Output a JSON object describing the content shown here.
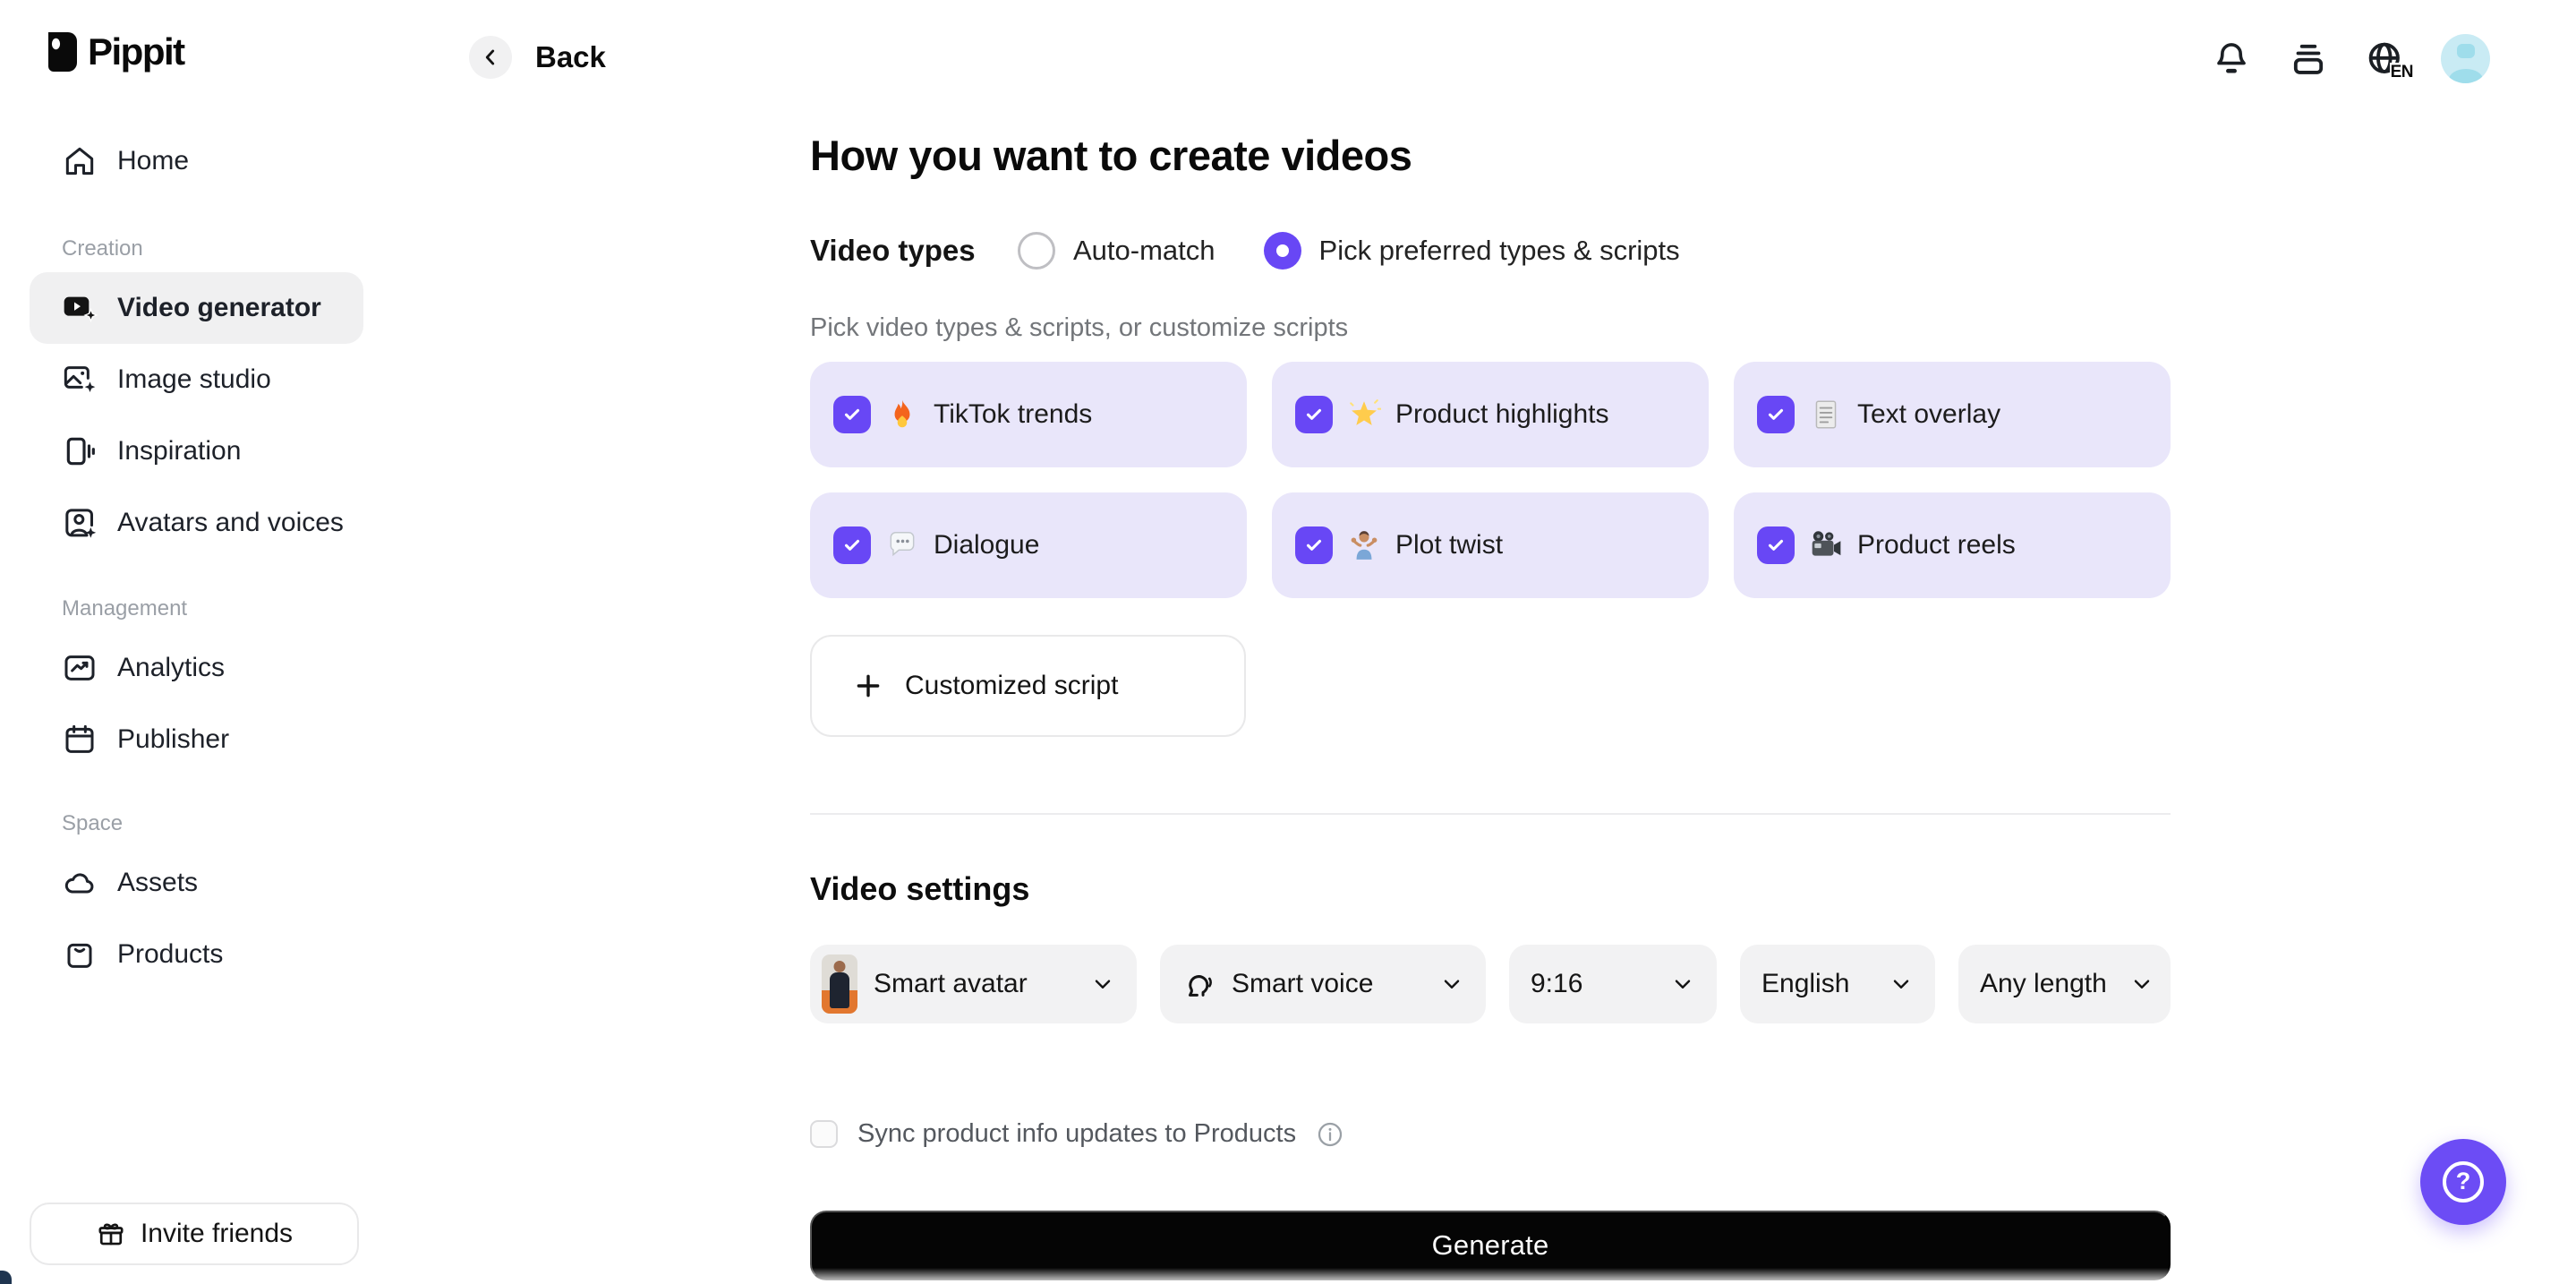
{
  "brand": {
    "name": "Pippit"
  },
  "header": {
    "back_label": "Back",
    "language": "EN"
  },
  "sidebar": {
    "home": {
      "label": "Home"
    },
    "sections": [
      {
        "label": "Creation",
        "items": [
          {
            "label": "Video generator",
            "active": true
          },
          {
            "label": "Image studio",
            "active": false
          },
          {
            "label": "Inspiration",
            "active": false
          },
          {
            "label": "Avatars and voices",
            "active": false
          }
        ]
      },
      {
        "label": "Management",
        "items": [
          {
            "label": "Analytics",
            "active": false
          },
          {
            "label": "Publisher",
            "active": false
          }
        ]
      },
      {
        "label": "Space",
        "items": [
          {
            "label": "Assets",
            "active": false
          },
          {
            "label": "Products",
            "active": false
          }
        ]
      }
    ],
    "invite_label": "Invite friends"
  },
  "main": {
    "title": "How you want to create videos",
    "video_types": {
      "label": "Video types",
      "options": [
        {
          "label": "Auto-match",
          "selected": false
        },
        {
          "label": "Pick preferred types & scripts",
          "selected": true
        }
      ],
      "hint": "Pick video types & scripts, or customize scripts",
      "cards": [
        {
          "emoji": "🔥",
          "label": "TikTok trends",
          "checked": true
        },
        {
          "emoji": "🌟",
          "label": "Product highlights",
          "checked": true
        },
        {
          "emoji": "📃",
          "label": "Text overlay",
          "checked": true
        },
        {
          "emoji": "💬",
          "label": "Dialogue",
          "checked": true
        },
        {
          "emoji": "🤷",
          "label": "Plot twist",
          "checked": true
        },
        {
          "emoji": "🎥",
          "label": "Product reels",
          "checked": true
        }
      ],
      "customized_script_label": "Customized script"
    },
    "video_settings": {
      "title": "Video settings",
      "dropdowns": [
        {
          "label": "Smart avatar"
        },
        {
          "label": "Smart voice"
        },
        {
          "label": "9:16"
        },
        {
          "label": "English"
        },
        {
          "label": "Any length"
        }
      ],
      "sync_label": "Sync product info updates to Products"
    },
    "generate_label": "Generate"
  },
  "fab": {
    "help_label": "?"
  },
  "colors": {
    "accent": "#6847F5",
    "help_fab": "#6C4CF5",
    "card_bg": "#E9E6FA",
    "active_item_bg": "#F0F0F1",
    "dropdown_bg": "#F2F2F3",
    "generate_bg": "#050505",
    "avatar_bg": "#C9EBF4"
  }
}
